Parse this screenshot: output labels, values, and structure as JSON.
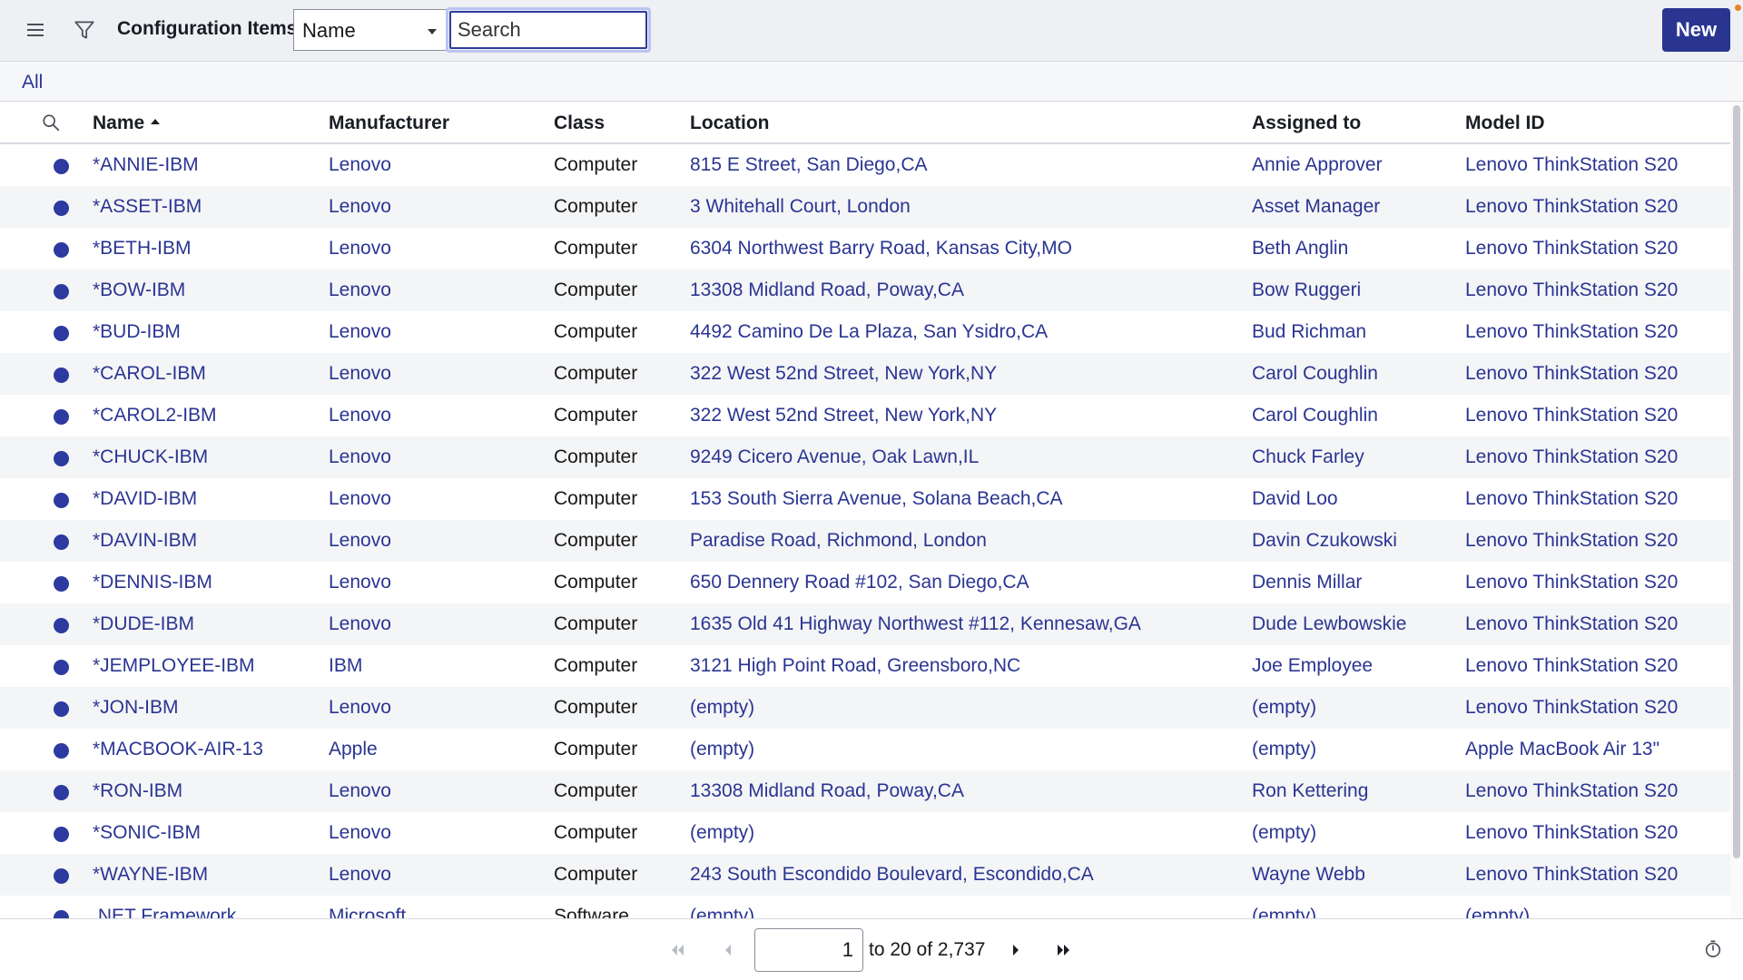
{
  "header": {
    "title": "Configuration Items",
    "field_select": "Name",
    "search_placeholder": "Search",
    "new_label": "New",
    "icons": [
      "hamburger-menu-icon",
      "filter-icon",
      "chevron-down-icon"
    ]
  },
  "breadcrumb": {
    "all": "All"
  },
  "table": {
    "columns": [
      "Name",
      "Manufacturer",
      "Class",
      "Location",
      "Assigned to",
      "Model ID"
    ],
    "sort": {
      "column": "Name",
      "direction": "ascending"
    },
    "rows": [
      {
        "name": "*ANNIE-IBM",
        "manufacturer": "Lenovo",
        "class": "Computer",
        "location": "815 E Street, San Diego,CA",
        "assigned_to": "Annie Approver",
        "model_id": "Lenovo ThinkStation S20"
      },
      {
        "name": "*ASSET-IBM",
        "manufacturer": "Lenovo",
        "class": "Computer",
        "location": "3 Whitehall Court, London",
        "assigned_to": "Asset Manager",
        "model_id": "Lenovo ThinkStation S20"
      },
      {
        "name": "*BETH-IBM",
        "manufacturer": "Lenovo",
        "class": "Computer",
        "location": "6304 Northwest Barry Road, Kansas City,MO",
        "assigned_to": "Beth Anglin",
        "model_id": "Lenovo ThinkStation S20"
      },
      {
        "name": "*BOW-IBM",
        "manufacturer": "Lenovo",
        "class": "Computer",
        "location": "13308 Midland Road, Poway,CA",
        "assigned_to": "Bow Ruggeri",
        "model_id": "Lenovo ThinkStation S20"
      },
      {
        "name": "*BUD-IBM",
        "manufacturer": "Lenovo",
        "class": "Computer",
        "location": "4492 Camino De La Plaza, San Ysidro,CA",
        "assigned_to": "Bud Richman",
        "model_id": "Lenovo ThinkStation S20"
      },
      {
        "name": "*CAROL-IBM",
        "manufacturer": "Lenovo",
        "class": "Computer",
        "location": "322 West 52nd Street, New York,NY",
        "assigned_to": "Carol Coughlin",
        "model_id": "Lenovo ThinkStation S20"
      },
      {
        "name": "*CAROL2-IBM",
        "manufacturer": "Lenovo",
        "class": "Computer",
        "location": "322 West 52nd Street, New York,NY",
        "assigned_to": "Carol Coughlin",
        "model_id": "Lenovo ThinkStation S20"
      },
      {
        "name": "*CHUCK-IBM",
        "manufacturer": "Lenovo",
        "class": "Computer",
        "location": "9249 Cicero Avenue, Oak Lawn,IL",
        "assigned_to": "Chuck Farley",
        "model_id": "Lenovo ThinkStation S20"
      },
      {
        "name": "*DAVID-IBM",
        "manufacturer": "Lenovo",
        "class": "Computer",
        "location": "153 South Sierra Avenue, Solana Beach,CA",
        "assigned_to": "David Loo",
        "model_id": "Lenovo ThinkStation S20"
      },
      {
        "name": "*DAVIN-IBM",
        "manufacturer": "Lenovo",
        "class": "Computer",
        "location": "Paradise Road, Richmond, London",
        "assigned_to": "Davin Czukowski",
        "model_id": "Lenovo ThinkStation S20"
      },
      {
        "name": "*DENNIS-IBM",
        "manufacturer": "Lenovo",
        "class": "Computer",
        "location": "650 Dennery Road #102, San Diego,CA",
        "assigned_to": "Dennis Millar",
        "model_id": "Lenovo ThinkStation S20"
      },
      {
        "name": "*DUDE-IBM",
        "manufacturer": "Lenovo",
        "class": "Computer",
        "location": "1635 Old 41 Highway Northwest #112, Kennesaw,GA",
        "assigned_to": "Dude Lewbowskie",
        "model_id": "Lenovo ThinkStation S20"
      },
      {
        "name": "*JEMPLOYEE-IBM",
        "manufacturer": "IBM",
        "class": "Computer",
        "location": "3121 High Point Road, Greensboro,NC",
        "assigned_to": "Joe Employee",
        "model_id": "Lenovo ThinkStation S20"
      },
      {
        "name": "*JON-IBM",
        "manufacturer": "Lenovo",
        "class": "Computer",
        "location": "(empty)",
        "assigned_to": "(empty)",
        "model_id": "Lenovo ThinkStation S20"
      },
      {
        "name": "*MACBOOK-AIR-13",
        "manufacturer": "Apple",
        "class": "Computer",
        "location": "(empty)",
        "assigned_to": "(empty)",
        "model_id": "Apple MacBook Air 13\""
      },
      {
        "name": "*RON-IBM",
        "manufacturer": "Lenovo",
        "class": "Computer",
        "location": "13308 Midland Road, Poway,CA",
        "assigned_to": "Ron Kettering",
        "model_id": "Lenovo ThinkStation S20"
      },
      {
        "name": "*SONIC-IBM",
        "manufacturer": "Lenovo",
        "class": "Computer",
        "location": "(empty)",
        "assigned_to": "(empty)",
        "model_id": "Lenovo ThinkStation S20"
      },
      {
        "name": "*WAYNE-IBM",
        "manufacturer": "Lenovo",
        "class": "Computer",
        "location": "243 South Escondido Boulevard, Escondido,CA",
        "assigned_to": "Wayne Webb",
        "model_id": "Lenovo ThinkStation S20"
      },
      {
        "name": ".NET Framework",
        "manufacturer": "Microsoft",
        "class": "Software",
        "location": "(empty)",
        "assigned_to": "(empty)",
        "model_id": "(empty)"
      }
    ]
  },
  "pager": {
    "current_page": "1",
    "range_text": "to 20 of 2,737",
    "icons": [
      "first-page-icon",
      "previous-page-icon",
      "next-page-icon",
      "last-page-icon",
      "timer-icon"
    ]
  },
  "colors": {
    "accent": "#2a3592",
    "status_dot": "#2d3aa0",
    "header_bg": "#eef0f3",
    "stripe": "#f4f5f7",
    "notification": "#e8862a"
  }
}
